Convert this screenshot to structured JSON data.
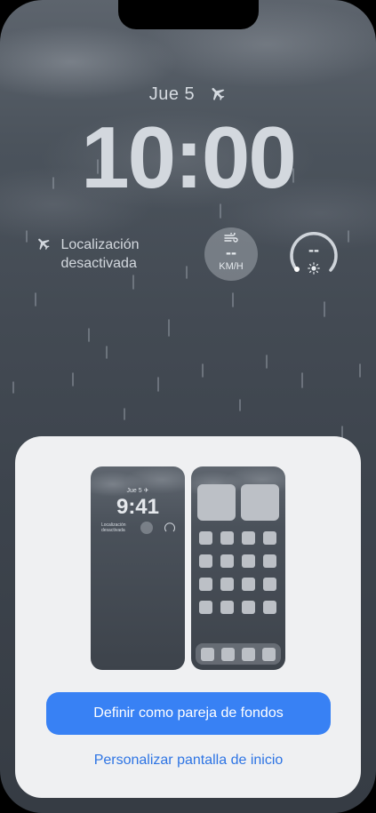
{
  "lock_screen": {
    "date": "Jue 5",
    "time": "10:00",
    "location_text": "Localización desactivada",
    "wind_value": "--",
    "wind_unit": "KM/H",
    "gauge_value": "--"
  },
  "preview": {
    "lock": {
      "date": "Jue 5",
      "time": "9:41",
      "location_text": "Localización desactivada"
    }
  },
  "actions": {
    "primary_label": "Definir como pareja de fondos",
    "secondary_label": "Personalizar pantalla de inicio"
  },
  "colors": {
    "primary": "#3881f4",
    "link": "#2d74e4",
    "sheet": "#eff0f2"
  },
  "icons": [
    "airplane-icon",
    "wind-icon",
    "sun-icon",
    "location-off-icon"
  ]
}
